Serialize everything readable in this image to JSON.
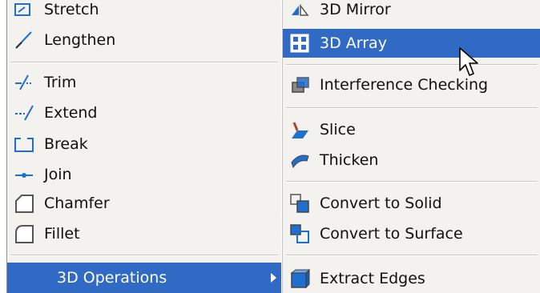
{
  "left_menu": {
    "items": [
      {
        "label": "Stretch",
        "icon": "stretch-icon"
      },
      {
        "label": "Lengthen",
        "icon": "lengthen-icon"
      },
      {
        "label": "Trim",
        "icon": "trim-icon"
      },
      {
        "label": "Extend",
        "icon": "extend-icon"
      },
      {
        "label": "Break",
        "icon": "break-icon"
      },
      {
        "label": "Join",
        "icon": "join-icon"
      },
      {
        "label": "Chamfer",
        "icon": "chamfer-icon"
      },
      {
        "label": "Fillet",
        "icon": "fillet-icon"
      },
      {
        "label": "3D Operations",
        "icon": "",
        "has_submenu": true,
        "highlighted": true
      }
    ]
  },
  "right_menu": {
    "items": [
      {
        "label": "3D Mirror",
        "icon": "3d-mirror-icon"
      },
      {
        "label": "3D Array",
        "icon": "3d-array-icon",
        "highlighted": true
      },
      {
        "label": "Interference Checking",
        "icon": "interference-checking-icon"
      },
      {
        "label": "Slice",
        "icon": "slice-icon"
      },
      {
        "label": "Thicken",
        "icon": "thicken-icon"
      },
      {
        "label": "Convert to Solid",
        "icon": "convert-to-solid-icon"
      },
      {
        "label": "Convert to Surface",
        "icon": "convert-to-surface-icon"
      },
      {
        "label": "Extract Edges",
        "icon": "extract-edges-icon"
      }
    ]
  },
  "colors": {
    "menu_bg": "#f3f2ee",
    "highlight": "#316ac5",
    "highlight_text": "#ffffff",
    "icon_blue": "#1f6fd1"
  }
}
